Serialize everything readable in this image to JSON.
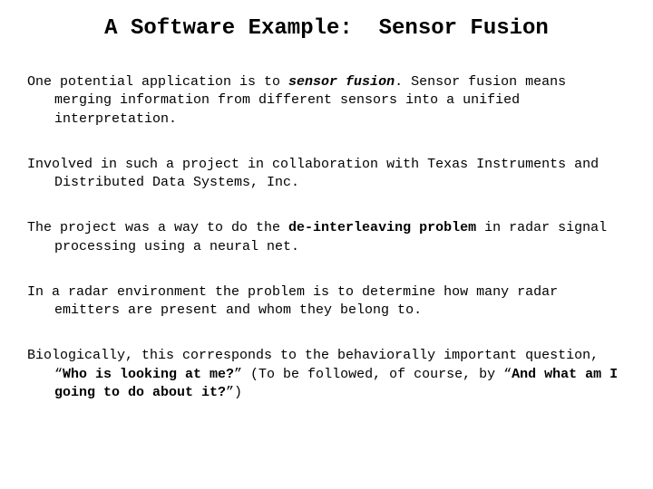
{
  "title": "A Software Example:  Sensor Fusion",
  "p1": {
    "a": "One potential application is to ",
    "b": "sensor fusion",
    "c": ".  Sensor fusion means merging information from different sensors into a unified interpretation."
  },
  "p2": "Involved in such a project in collaboration with Texas Instruments and Distributed Data Systems, Inc.",
  "p3": {
    "a": "The project was a way to do the ",
    "b": "de-interleaving problem",
    "c": " in radar signal processing using a neural net."
  },
  "p4": "In a radar environment the problem is to determine how many radar emitters are present and whom they belong to.",
  "p5": {
    "a": "Biologically, this corresponds to the behaviorally important question, “",
    "b": "Who is looking at me?",
    "c": "”  (To be followed, of course, by “",
    "d": "And what am I going to do about it?",
    "e": "”)"
  }
}
